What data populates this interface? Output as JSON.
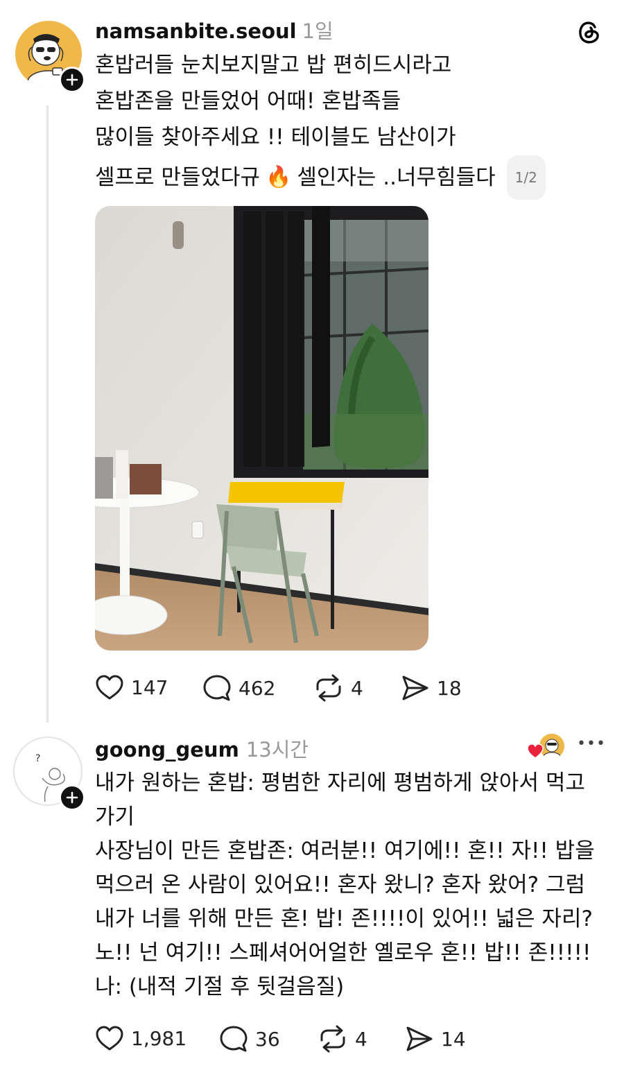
{
  "post1": {
    "username": "namsanbite.seoul",
    "time": "1일",
    "lines": [
      "혼밥러들 눈치보지말고 밥 편히드시라고",
      "혼밥존을 만들었어 어때! 혼밥족들",
      "많이들 찾아주세요 !! 테이블도 남산이가",
      "셀프로 만들었다규",
      "셀인자는 ..너무힘들다"
    ],
    "emoji": "🔥",
    "pager": "1/2",
    "actions": {
      "likes": "147",
      "replies": "462",
      "reposts": "4",
      "shares": "18"
    }
  },
  "post2": {
    "username": "goong_geum",
    "time": "13시간",
    "more": "•••",
    "lines": [
      "내가 원하는 혼밥: 평범한 자리에 평범하게 앉아서 먹고",
      "가기",
      "사장님이 만든 혼밥존: 여러분!! 여기에!! 혼!! 자!! 밥을",
      "먹으러 온 사람이 있어요!! 혼자 왔니? 혼자 왔어? 그럼",
      "내가 너를 위해 만든 혼! 밥! 존!!!!이 있어!! 넓은 자리?",
      "노!! 넌 여기!! 스페셔어어얼한 옐로우 혼!! 밥!! 존!!!!!",
      "나: (내적 기절 후 뒷걸음질)"
    ],
    "actions": {
      "likes": "1,981",
      "replies": "36",
      "reposts": "4",
      "shares": "14"
    }
  },
  "icons": {
    "app": "threads-logo-icon",
    "follow": "plus-icon",
    "like": "heart-icon",
    "reply": "comment-icon",
    "repost": "repost-icon",
    "share": "send-icon",
    "author_liked": "red-heart-icon"
  },
  "colors": {
    "avatar_bg": "#f0b84a",
    "liked_heart": "#e8233b",
    "muted_text": "#999999"
  }
}
